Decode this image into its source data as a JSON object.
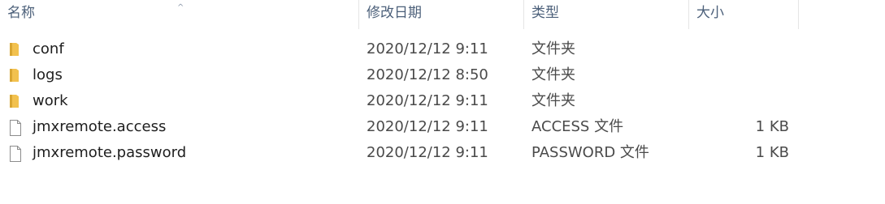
{
  "columns": {
    "name": "名称",
    "date": "修改日期",
    "type": "类型",
    "size": "大小",
    "sort_indicator": "^"
  },
  "colors": {
    "header_text": "#4c607a",
    "folder_yellow": "#f2c14e",
    "folder_shade": "#d9a632",
    "file_border": "#8c8c8c"
  },
  "files": [
    {
      "icon": "folder-icon",
      "name": "conf",
      "date": "2020/12/12 9:11",
      "type": "文件夹",
      "size": ""
    },
    {
      "icon": "folder-icon",
      "name": "logs",
      "date": "2020/12/12 8:50",
      "type": "文件夹",
      "size": ""
    },
    {
      "icon": "folder-icon",
      "name": "work",
      "date": "2020/12/12 9:11",
      "type": "文件夹",
      "size": ""
    },
    {
      "icon": "file-icon",
      "name": "jmxremote.access",
      "date": "2020/12/12 9:11",
      "type": "ACCESS 文件",
      "size": "1 KB"
    },
    {
      "icon": "file-icon",
      "name": "jmxremote.password",
      "date": "2020/12/12 9:11",
      "type": "PASSWORD 文件",
      "size": "1 KB"
    }
  ]
}
